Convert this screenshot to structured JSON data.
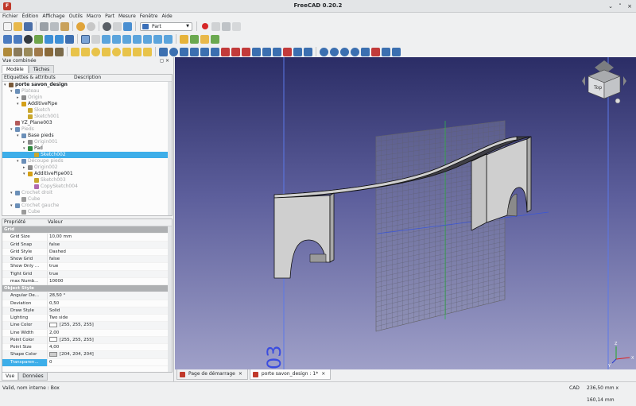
{
  "window": {
    "title": "FreeCAD 0.20.2",
    "app_icon_label": "F"
  },
  "menu": [
    "Fichier",
    "Édition",
    "Affichage",
    "Outils",
    "Macro",
    "Part",
    "Mesure",
    "Fenêtre",
    "Aide"
  ],
  "workbench_combo": {
    "value": "Part"
  },
  "combo_view": {
    "title": "Vue combinée",
    "tabs": [
      "Modèle",
      "Tâches"
    ],
    "tree_headers": {
      "labels": "Étiquettes & attributs",
      "description": "Description"
    },
    "tree": [
      {
        "label": "porte savon_design",
        "level": 0,
        "exp": "v",
        "icon": "document",
        "bold": true
      },
      {
        "label": "Plateau",
        "level": 1,
        "exp": "v",
        "icon": "body",
        "dim": true
      },
      {
        "label": "Origin",
        "level": 2,
        "exp": ">",
        "icon": "origin",
        "dim": true
      },
      {
        "label": "AdditivePipe",
        "level": 2,
        "exp": "v",
        "icon": "pipe"
      },
      {
        "label": "Sketch",
        "level": 3,
        "exp": "",
        "icon": "sketch",
        "dim": true
      },
      {
        "label": "Sketch001",
        "level": 3,
        "exp": "",
        "icon": "sketch",
        "dim": true
      },
      {
        "label": "YZ_Plane003",
        "level": 1,
        "exp": "",
        "icon": "plane"
      },
      {
        "label": "Pieds",
        "level": 1,
        "exp": "v",
        "icon": "body",
        "dim": true
      },
      {
        "label": "Base pieds",
        "level": 2,
        "exp": "v",
        "icon": "body"
      },
      {
        "label": "Origin001",
        "level": 3,
        "exp": ">",
        "icon": "origin",
        "dim": true
      },
      {
        "label": "Pad",
        "level": 3,
        "exp": "v",
        "icon": "pad"
      },
      {
        "label": "Sketch002",
        "level": 4,
        "exp": "",
        "icon": "sketch",
        "selected": true
      },
      {
        "label": "Découpe pieds",
        "level": 2,
        "exp": "v",
        "icon": "body",
        "dim": true
      },
      {
        "label": "Origin002",
        "level": 3,
        "exp": ">",
        "icon": "origin",
        "dim": true
      },
      {
        "label": "AdditivePipe001",
        "level": 3,
        "exp": "v",
        "icon": "pipe"
      },
      {
        "label": "Sketch003",
        "level": 4,
        "exp": "",
        "icon": "sketch",
        "dim": true
      },
      {
        "label": "CopySketch004",
        "level": 4,
        "exp": "",
        "icon": "sketch2",
        "dim": true
      },
      {
        "label": "Crochet droit",
        "level": 1,
        "exp": "v",
        "icon": "body",
        "dim": true
      },
      {
        "label": "Cube",
        "level": 2,
        "exp": "",
        "icon": "cube",
        "dim": true
      },
      {
        "label": "Crochet gauche",
        "level": 1,
        "exp": "v",
        "icon": "body",
        "dim": true
      },
      {
        "label": "Cube",
        "level": 2,
        "exp": "",
        "icon": "cube",
        "dim": true
      }
    ],
    "props_headers": {
      "property": "Propriété",
      "value": "Valeur"
    },
    "properties": [
      {
        "group": "Grid"
      },
      {
        "name": "Grid Size",
        "value": "10,00 mm"
      },
      {
        "name": "Grid Snap",
        "value": "false"
      },
      {
        "name": "Grid Style",
        "value": "Dashed"
      },
      {
        "name": "Show Grid",
        "value": "false"
      },
      {
        "name": "Show Only ...",
        "value": "true"
      },
      {
        "name": "Tight Grid",
        "value": "true"
      },
      {
        "name": "max Numb...",
        "value": "10000"
      },
      {
        "group": "Object Style"
      },
      {
        "name": "Angular De...",
        "value": "28,50 °"
      },
      {
        "name": "Deviation",
        "value": "0,50"
      },
      {
        "name": "Draw Style",
        "value": "Solid"
      },
      {
        "name": "Lighting",
        "value": "Two side"
      },
      {
        "name": "Line Color",
        "value": "[255, 255, 255]",
        "swatch": "#ffffff"
      },
      {
        "name": "Line Width",
        "value": "2,00"
      },
      {
        "name": "Point Color",
        "value": "[255, 255, 255]",
        "swatch": "#ffffff"
      },
      {
        "name": "Point Size",
        "value": "4,00"
      },
      {
        "name": "Shape Color",
        "value": "[204, 204, 204]",
        "swatch": "#cccccc"
      },
      {
        "name": "Transparen...",
        "value": "0",
        "selected": true
      }
    ],
    "bottom_tabs": [
      "Vue",
      "Données"
    ]
  },
  "viewport": {
    "nav_cube_face": "Top",
    "sketch_label": "03",
    "axis_labels": {
      "x": "X",
      "y": "Y",
      "z": "Z"
    },
    "colors": {
      "top": "#2b2d66",
      "bottom": "#9fa0c8",
      "solid": "#cacaca",
      "edge": "#111111",
      "grid": "#6e6e6e"
    }
  },
  "doc_tabs": [
    {
      "label": "Page de démarrage",
      "close": "×"
    },
    {
      "label": "porte savon_design : 1*",
      "close": "×",
      "active": true
    }
  ],
  "status": {
    "left": "Valid, nom interne : Box",
    "nav": "CAD",
    "dimensions": "236,50 mm x 160,14 mm"
  }
}
